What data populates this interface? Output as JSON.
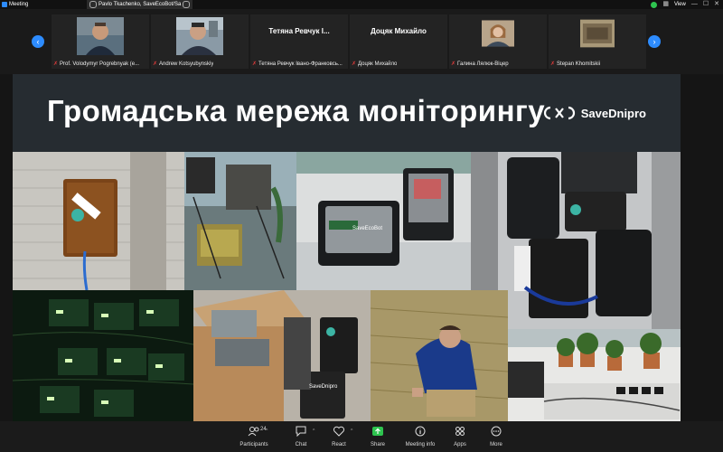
{
  "window": {
    "title": "Meeting",
    "speaker_label": "Pavlo Tkachenko, SaveEcoBot/Sa",
    "view_label": "View"
  },
  "participants": [
    {
      "caption": "Prof. Volodymyr Pogrebnyak (e...",
      "video": true
    },
    {
      "caption": "Andrew Kotsyubynskiy",
      "video": true
    },
    {
      "name": "Тетяна Ревчук І...",
      "caption": "Тетяна Ревчук Івано-Франковсь...",
      "video": false
    },
    {
      "name": "Доцяк Михайло",
      "caption": "Доцяк Михайло",
      "video": false
    },
    {
      "caption": "Галина Лялюк-Віцер",
      "video": true
    },
    {
      "caption": "Stepan Khomitskii",
      "video": true
    }
  ],
  "slide": {
    "title": "Громадська мережа моніторингу",
    "logo_text": "SaveDnipro",
    "device_label_1": "SaveEcoBot",
    "device_label_2": "SaveEcoBot",
    "device_label_3": "SaveDnipro"
  },
  "toolbar": {
    "participants_label": "Participants",
    "participants_count": "24",
    "chat_label": "Chat",
    "react_label": "React",
    "share_label": "Share",
    "meeting_info_label": "Meeting info",
    "apps_label": "Apps",
    "more_label": "More"
  },
  "colors": {
    "accent": "#2d8cff",
    "share_green": "#2ec44f",
    "muted_red": "#e23b3b"
  }
}
